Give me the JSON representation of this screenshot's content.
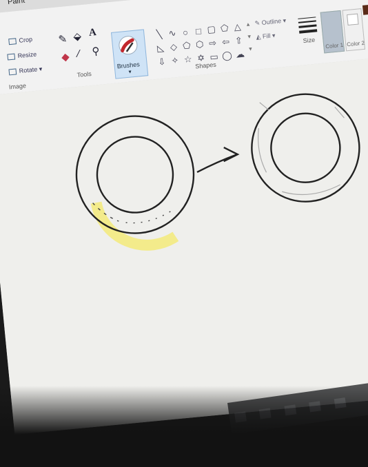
{
  "window": {
    "title": "Paint"
  },
  "ribbon": {
    "image_group": {
      "label": "Image",
      "commands": [
        {
          "label": "Crop"
        },
        {
          "label": "Resize"
        },
        {
          "label": "Rotate"
        }
      ]
    },
    "tools_group": {
      "label": "Tools"
    },
    "brushes": {
      "label": "Brushes"
    },
    "shapes_group": {
      "label": "Shapes",
      "outline_label": "Outline",
      "fill_label": "Fill"
    },
    "size": {
      "label": "Size"
    },
    "colors": {
      "color1_label": "Color 1",
      "color2_label": "Color 2"
    }
  },
  "icons": {
    "tools": [
      "pencil-icon",
      "fill-icon",
      "text-icon",
      "eraser-icon",
      "color-picker-icon",
      "magnifier-icon"
    ],
    "shapes": [
      "line",
      "curve",
      "oval",
      "rectangle",
      "rounded-rectangle",
      "polygon",
      "triangle",
      "right-triangle",
      "diamond",
      "pentagon",
      "hexagon",
      "right-arrow",
      "left-arrow",
      "up-arrow",
      "down-arrow",
      "four-point-star",
      "five-point-star",
      "six-point-star",
      "rounded-callout",
      "oval-callout",
      "cloud-callout"
    ]
  },
  "colors": {
    "color1": "#b6c1cd",
    "color2": "#ffffff",
    "highlight": "#f3ea7a",
    "ink": "#222222"
  }
}
